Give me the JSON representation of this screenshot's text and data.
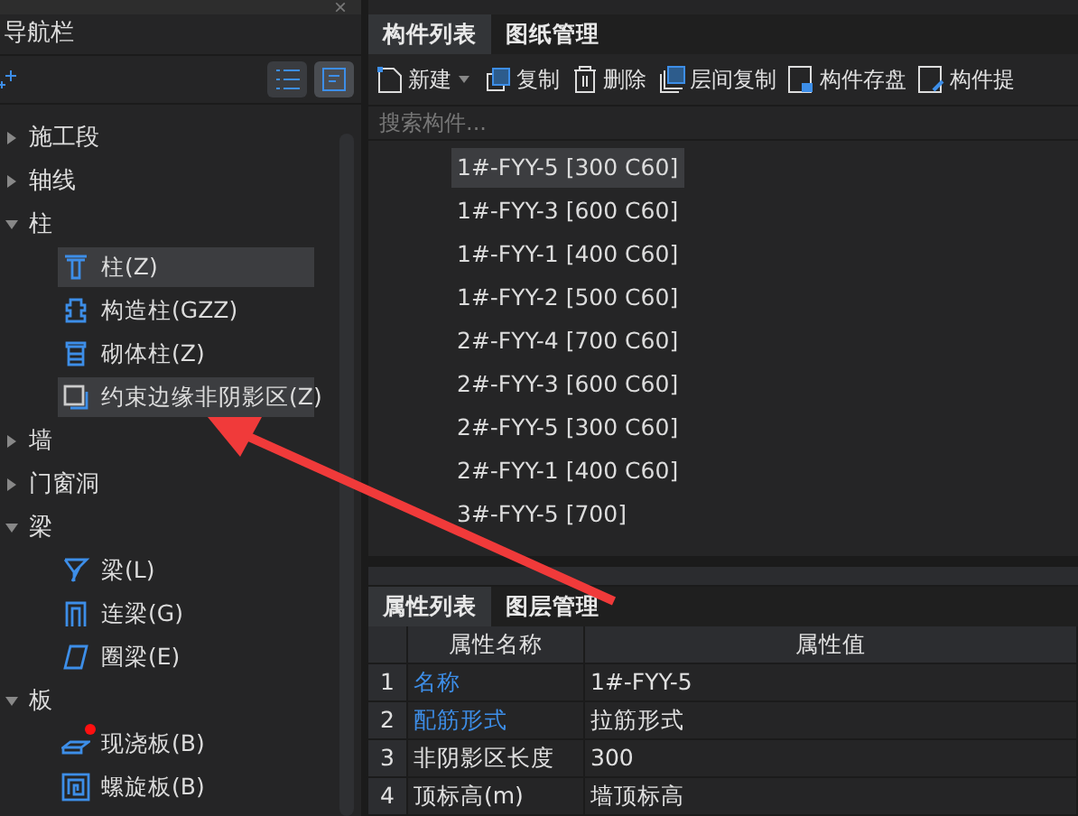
{
  "nav": {
    "title": "导航栏",
    "close": "×",
    "view_modes": [
      {
        "selected": false
      },
      {
        "selected": true
      }
    ],
    "tree": [
      {
        "label": "施工段",
        "expanded": false
      },
      {
        "label": "轴线",
        "expanded": false
      },
      {
        "label": "柱",
        "expanded": true,
        "children": [
          {
            "label": "柱(Z)",
            "selected": true,
            "flagged": false
          },
          {
            "label": "构造柱(GZZ)",
            "selected": false,
            "flagged": false
          },
          {
            "label": "砌体柱(Z)",
            "selected": false,
            "flagged": false
          },
          {
            "label": "约束边缘非阴影区(Z)",
            "selected": true,
            "flagged": false
          }
        ]
      },
      {
        "label": "墙",
        "expanded": false
      },
      {
        "label": "门窗洞",
        "expanded": false
      },
      {
        "label": "梁",
        "expanded": true,
        "children": [
          {
            "label": "梁(L)",
            "selected": false,
            "flagged": false
          },
          {
            "label": "连梁(G)",
            "selected": false,
            "flagged": false
          },
          {
            "label": "圈梁(E)",
            "selected": false,
            "flagged": false
          }
        ]
      },
      {
        "label": "板",
        "expanded": true,
        "children": [
          {
            "label": "现浇板(B)",
            "selected": false,
            "flagged": true
          },
          {
            "label": "螺旋板(B)",
            "selected": false,
            "flagged": false
          }
        ]
      }
    ]
  },
  "components": {
    "tabs": [
      {
        "label": "构件列表",
        "selected": true
      },
      {
        "label": "图纸管理",
        "selected": false
      }
    ],
    "toolbar": [
      {
        "label": "新建",
        "dropdown": true
      },
      {
        "label": "复制",
        "dropdown": false
      },
      {
        "label": "删除",
        "dropdown": false
      },
      {
        "label": "层间复制",
        "dropdown": false
      },
      {
        "label": "构件存盘",
        "dropdown": false
      },
      {
        "label": "构件提",
        "dropdown": false
      }
    ],
    "search": {
      "placeholder": "搜索构件..."
    },
    "items": [
      {
        "label": "1#-FYY-5 [300 C60]",
        "selected": true
      },
      {
        "label": "1#-FYY-3 [600 C60]",
        "selected": false
      },
      {
        "label": "1#-FYY-1 [400 C60]",
        "selected": false
      },
      {
        "label": "1#-FYY-2 [500 C60]",
        "selected": false
      },
      {
        "label": "2#-FYY-4 [700 C60]",
        "selected": false
      },
      {
        "label": "2#-FYY-3 [600 C60]",
        "selected": false
      },
      {
        "label": "2#-FYY-5 [300 C60]",
        "selected": false
      },
      {
        "label": "2#-FYY-1 [400 C60]",
        "selected": false
      },
      {
        "label": "3#-FYY-5 [700]",
        "selected": false
      }
    ]
  },
  "properties": {
    "tabs": [
      {
        "label": "属性列表",
        "selected": true
      },
      {
        "label": "图层管理",
        "selected": false
      }
    ],
    "columns": [
      "属性名称",
      "属性值"
    ],
    "rows": [
      {
        "index": "1",
        "name": "名称",
        "value": "1#-FYY-5",
        "color": "#3d8ee8"
      },
      {
        "index": "2",
        "name": "配筋形式",
        "value": "拉筋形式",
        "color": "#3d8ee8"
      },
      {
        "index": "3",
        "name": "非阴影区长度",
        "value": "300",
        "color": "#e0e0e0"
      },
      {
        "index": "4",
        "name": "顶标高(m)",
        "value": "墙顶标高",
        "color": "#e0e0e0"
      }
    ]
  }
}
